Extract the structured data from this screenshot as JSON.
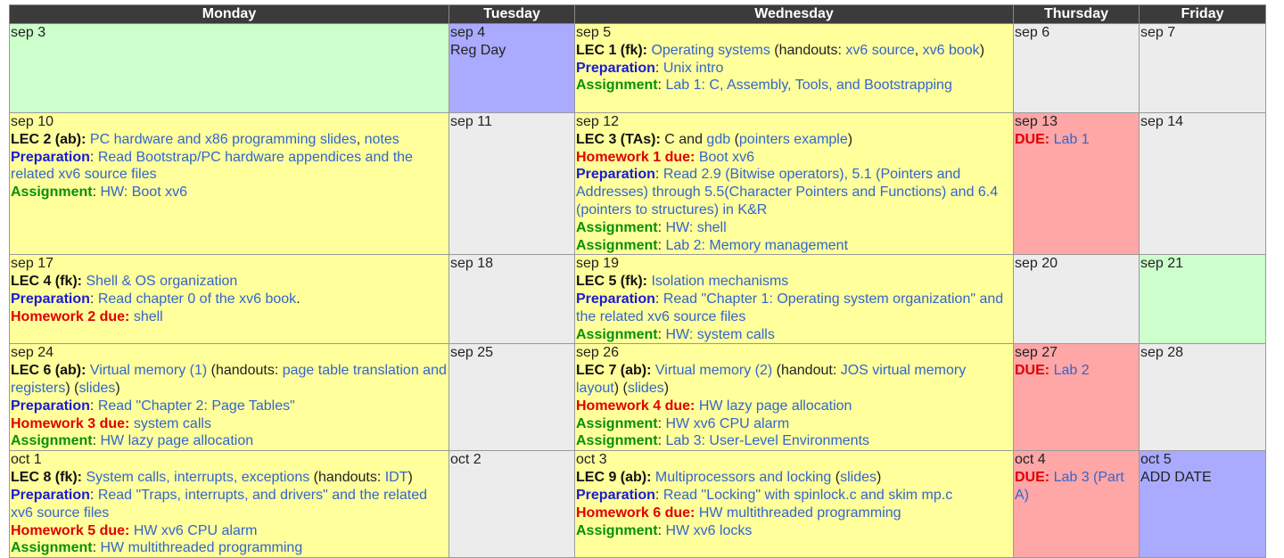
{
  "header": {
    "days": [
      "Monday",
      "Tuesday",
      "Wednesday",
      "Thursday",
      "Friday"
    ]
  },
  "colors": {
    "green": "#ccffcc",
    "yellow": "#ffff9c",
    "gray": "#ececec",
    "red": "#ffa6a6",
    "blue": "#aaaaff",
    "link": "#3366cc",
    "header": "#3b3b3b"
  },
  "rows": [
    {
      "mon": {
        "date": "sep 3"
      },
      "tue": {
        "date": "sep 4",
        "note": "Reg Day"
      },
      "wed": {
        "date": "sep 5",
        "lec": {
          "label": "LEC 1 (fk):",
          "topic": "Operating systems",
          "handouts_pre": "(handouts:",
          "handout1": "xv6 source",
          "comma": ",",
          "handout2": "xv6 book",
          "close": ")"
        },
        "prep": {
          "label": "Preparation",
          "text": "Unix intro"
        },
        "asg": {
          "label": "Assignment",
          "text": "Lab 1: C, Assembly, Tools, and Bootstrapping"
        }
      },
      "thu": {
        "date": "sep 6"
      },
      "fri": {
        "date": "sep 7"
      }
    },
    {
      "mon": {
        "date": "sep 10",
        "lec": {
          "label": "LEC 2 (ab):",
          "topic": "PC hardware and x86 programming slides",
          "comma": ",",
          "notes": "notes"
        },
        "prep": {
          "label": "Preparation",
          "text": "Read Bootstrap/PC hardware appendices and the related xv6 source files"
        },
        "asg": {
          "label": "Assignment",
          "text": "HW: Boot xv6"
        }
      },
      "tue": {
        "date": "sep 11"
      },
      "wed": {
        "date": "sep 12",
        "lec": {
          "label": "LEC 3 (TAs):",
          "pre": "C and",
          "gdb": "gdb",
          "open": "(",
          "example": "pointers example",
          "close": ")"
        },
        "hw": {
          "label": "Homework 1 due:",
          "text": "Boot xv6"
        },
        "prep": {
          "label": "Preparation",
          "text": "Read 2.9 (Bitwise operators), 5.1 (Pointers and Addresses) through 5.5(Character Pointers and Functions) and 6.4 (pointers to structures) in K&R"
        },
        "asg1": {
          "label": "Assignment",
          "text": "HW: shell"
        },
        "asg2": {
          "label": "Assignment",
          "text": "Lab 2: Memory management"
        }
      },
      "thu": {
        "date": "sep 13",
        "due": {
          "label": "DUE:",
          "text": "Lab 1"
        }
      },
      "fri": {
        "date": "sep 14"
      }
    },
    {
      "mon": {
        "date": "sep 17",
        "lec": {
          "label": "LEC 4 (fk):",
          "topic": "Shell & OS organization"
        },
        "prep": {
          "label": "Preparation",
          "text": "Read chapter 0 of the xv6 book",
          "period": "."
        },
        "hw": {
          "label": "Homework 2 due:",
          "text": "shell"
        }
      },
      "tue": {
        "date": "sep 18"
      },
      "wed": {
        "date": "sep 19",
        "lec": {
          "label": "LEC 5 (fk):",
          "topic": "Isolation mechanisms"
        },
        "prep": {
          "label": "Preparation",
          "text": "Read \"Chapter 1: Operating system organization\" and the related xv6 source files"
        },
        "asg": {
          "label": "Assignment",
          "text": "HW: system calls"
        }
      },
      "thu": {
        "date": "sep 20"
      },
      "fri": {
        "date": "sep 21"
      }
    },
    {
      "mon": {
        "date": "sep 24",
        "lec": {
          "label": "LEC 6 (ab):",
          "topic": "Virtual memory (1)",
          "handouts_pre": "(handouts:",
          "handout1": "page table translation and registers",
          "mid": ") (",
          "slides": "slides",
          "close": ")"
        },
        "prep": {
          "label": "Preparation",
          "text": "Read \"Chapter 2: Page Tables\""
        },
        "hw": {
          "label": "Homework 3 due:",
          "text": "system calls"
        },
        "asg": {
          "label": "Assignment",
          "text": "HW lazy page allocation"
        }
      },
      "tue": {
        "date": "sep 25"
      },
      "wed": {
        "date": "sep 26",
        "lec": {
          "label": "LEC 7 (ab):",
          "topic": "Virtual memory (2)",
          "handouts_pre": "(handout:",
          "handout1": "JOS virtual memory layout",
          "mid": ") (",
          "slides": "slides",
          "close": ")"
        },
        "hw": {
          "label": "Homework 4 due:",
          "text": "HW lazy page allocation"
        },
        "asg1": {
          "label": "Assignment",
          "text": "HW xv6 CPU alarm"
        },
        "asg2": {
          "label": "Assignment",
          "text": "Lab 3: User-Level Environments"
        }
      },
      "thu": {
        "date": "sep 27",
        "due": {
          "label": "DUE:",
          "text": "Lab 2"
        }
      },
      "fri": {
        "date": "sep 28"
      }
    },
    {
      "mon": {
        "date": "oct 1",
        "lec": {
          "label": "LEC 8 (fk):",
          "topic": "System calls, interrupts, exceptions",
          "handouts_pre": "(handouts:",
          "handout1": "IDT",
          "close": ")"
        },
        "prep": {
          "label": "Preparation",
          "text": "Read \"Traps, interrupts, and drivers\" and the related xv6 source files"
        },
        "hw": {
          "label": "Homework 5 due:",
          "text": "HW xv6 CPU alarm"
        },
        "asg": {
          "label": "Assignment",
          "text": "HW multithreaded programming"
        }
      },
      "tue": {
        "date": "oct 2"
      },
      "wed": {
        "date": "oct 3",
        "lec": {
          "label": "LEC 9 (ab):",
          "topic": "Multiprocessors and locking",
          "open": "(",
          "slides": "slides",
          "close": ")"
        },
        "prep": {
          "label": "Preparation",
          "text": "Read \"Locking\" with spinlock.c and skim mp.c"
        },
        "hw": {
          "label": "Homework 6 due:",
          "text": "HW multithreaded programming"
        },
        "asg": {
          "label": "Assignment",
          "text": "HW xv6 locks"
        }
      },
      "thu": {
        "date": "oct 4",
        "due": {
          "label": "DUE:",
          "text": "Lab 3 (Part A)"
        }
      },
      "fri": {
        "date": "oct 5",
        "note": "ADD DATE"
      }
    }
  ]
}
